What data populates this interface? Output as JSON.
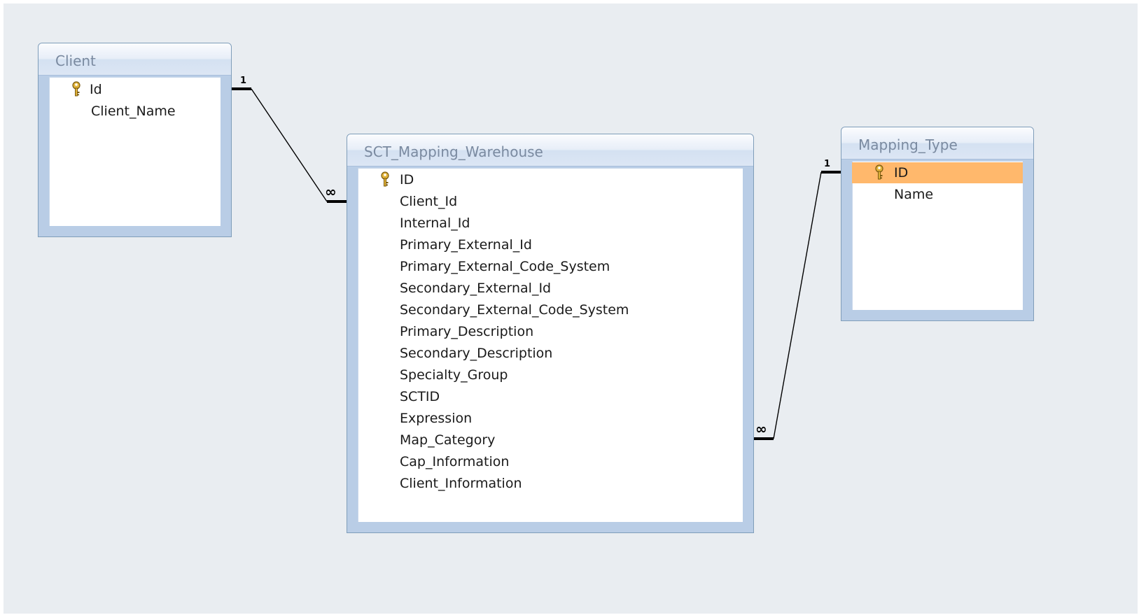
{
  "canvas": {
    "background": "#e9edf1"
  },
  "tables": [
    {
      "id": "client",
      "title": "Client",
      "fields": [
        {
          "name": "Id",
          "pk": true
        },
        {
          "name": "Client_Name",
          "pk": false
        }
      ]
    },
    {
      "id": "warehouse",
      "title": "SCT_Mapping_Warehouse",
      "fields": [
        {
          "name": "ID",
          "pk": true
        },
        {
          "name": "Client_Id"
        },
        {
          "name": "Internal_Id"
        },
        {
          "name": "Primary_External_Id"
        },
        {
          "name": "Primary_External_Code_System"
        },
        {
          "name": "Secondary_External_Id"
        },
        {
          "name": "Secondary_External_Code_System"
        },
        {
          "name": "Primary_Description"
        },
        {
          "name": "Secondary_Description"
        },
        {
          "name": "Specialty_Group"
        },
        {
          "name": "SCTID"
        },
        {
          "name": "Expression"
        },
        {
          "name": "Map_Category"
        },
        {
          "name": "Cap_Information"
        },
        {
          "name": "Client_Information"
        }
      ]
    },
    {
      "id": "mapping-type",
      "title": "Mapping_Type",
      "fields": [
        {
          "name": "ID",
          "pk": true,
          "selected": true
        },
        {
          "name": "Name"
        }
      ]
    }
  ],
  "relationships": [
    {
      "from": "Client.Id",
      "to": "SCT_Mapping_Warehouse.Client_Id",
      "one_label": "1",
      "many_label": "∞"
    },
    {
      "from": "Mapping_Type.ID",
      "to": "SCT_Mapping_Warehouse",
      "one_label": "1",
      "many_label": "∞"
    }
  ],
  "colors": {
    "selected_row": "#ffb86c",
    "key_icon": "#e2b43a",
    "line": "#000000"
  },
  "icons": {
    "primary_key": "key-icon"
  }
}
